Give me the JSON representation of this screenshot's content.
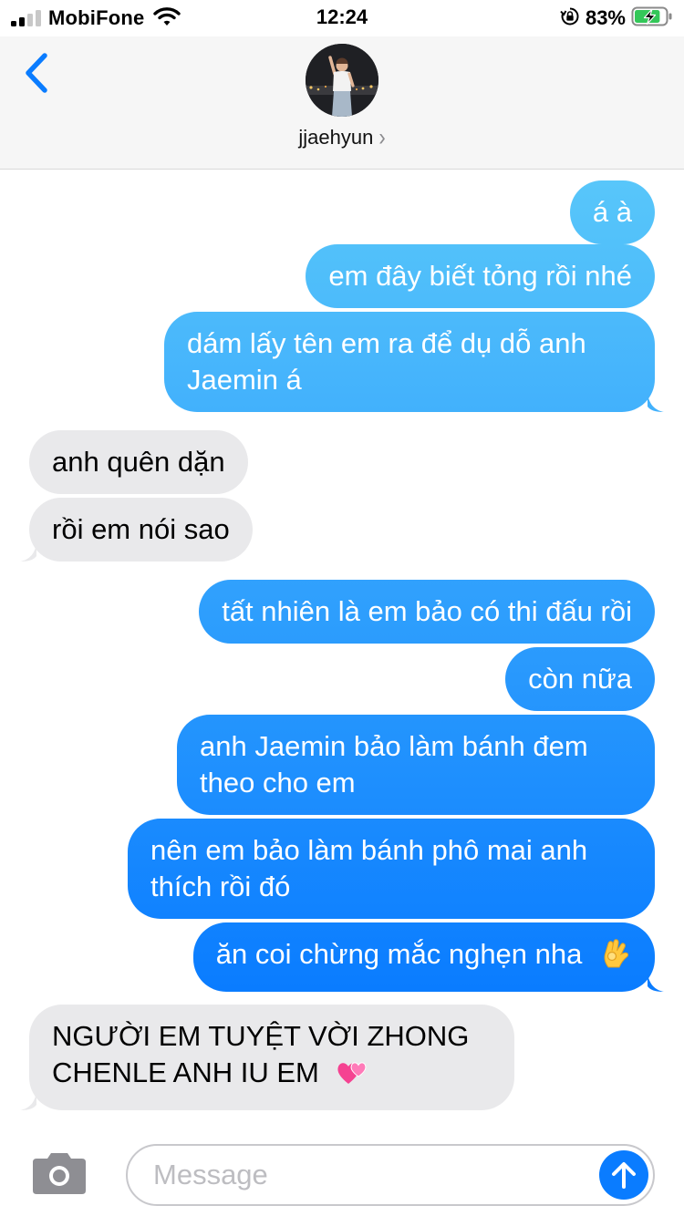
{
  "status_bar": {
    "carrier": "MobiFone",
    "time": "12:24",
    "battery_percent": "83%",
    "battery_level": 0.83,
    "icons": [
      "signal-icon",
      "wifi-icon",
      "orientation-lock-icon",
      "battery-charging-icon"
    ]
  },
  "header": {
    "contact_name": "jjaehyun",
    "back_icon": "chevron-left-icon",
    "detail_icon": "chevron-right-icon"
  },
  "colors": {
    "sent_top": "#5ac8fa",
    "sent_bottom": "#0a7cff",
    "received": "#e9e9eb",
    "accent": "#0a7cff"
  },
  "messages": [
    {
      "dir": "sent",
      "text": "á à"
    },
    {
      "dir": "sent",
      "text": "em đây biết tỏng rồi nhé"
    },
    {
      "dir": "sent",
      "text": "dám lấy tên em ra để dụ dỗ anh Jaemin á"
    },
    {
      "dir": "recv",
      "text": "anh quên dặn"
    },
    {
      "dir": "recv",
      "text": "rồi em nói sao"
    },
    {
      "dir": "sent",
      "text": "tất nhiên là em bảo có thi đấu rồi"
    },
    {
      "dir": "sent",
      "text": "còn nữa"
    },
    {
      "dir": "sent",
      "text": "anh Jaemin bảo làm bánh đem theo cho em"
    },
    {
      "dir": "sent",
      "text": "nên em bảo làm bánh phô mai anh thích rồi đó"
    },
    {
      "dir": "sent",
      "text": "ăn coi chừng mắc nghẹn nha",
      "emoji": "ok-hand-emoji"
    },
    {
      "dir": "recv",
      "text": "NGƯỜI EM TUYỆT VỜI ZHONG CHENLE ANH IU EM",
      "emoji": "two-hearts-emoji"
    }
  ],
  "composer": {
    "placeholder": "Message",
    "value": "",
    "camera_icon": "camera-icon",
    "send_icon": "arrow-up-icon"
  }
}
